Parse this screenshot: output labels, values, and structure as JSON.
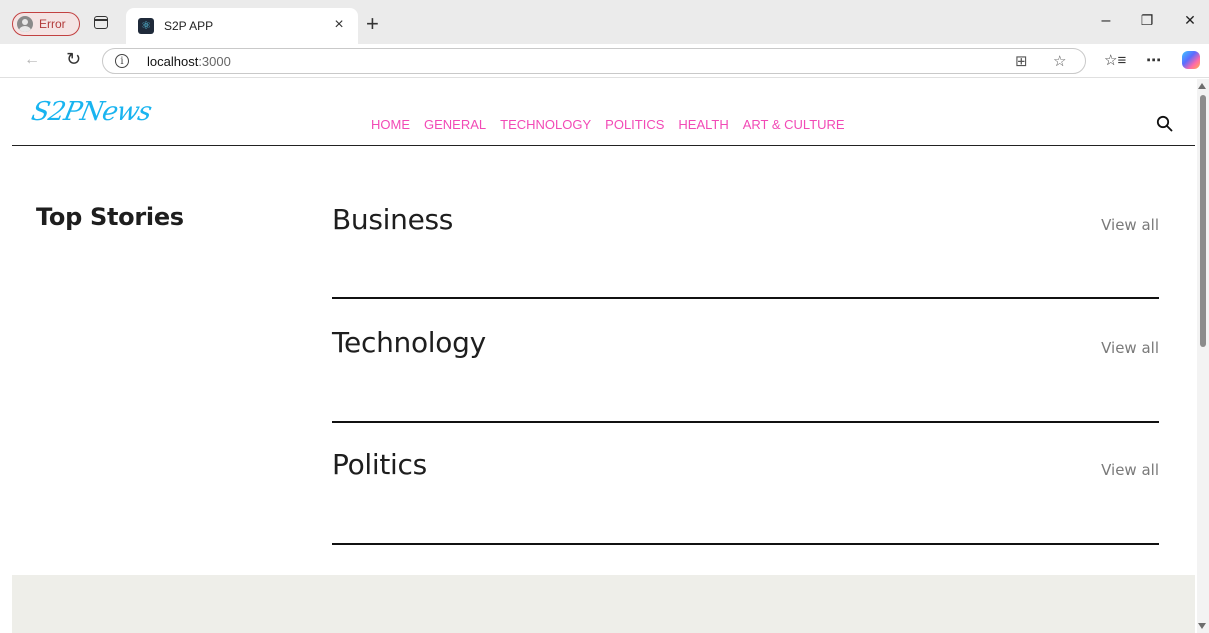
{
  "browser": {
    "profile_label": "Error",
    "tab_title": "S2P APP",
    "tab_close": "×",
    "new_tab": "+",
    "url_host": "localhost",
    "url_port": ":3000",
    "window_controls": {
      "minimize": "–",
      "restore": "❐",
      "close": "✕"
    },
    "icons": [
      "back-arrow-icon",
      "reload-icon",
      "info-icon",
      "split-screen-icon",
      "favorite-star-icon",
      "favorites-list-icon",
      "more-icon",
      "copilot-icon"
    ]
  },
  "site": {
    "logo_text": "S2PNews",
    "nav": [
      "HOME",
      "GENERAL",
      "TECHNOLOGY",
      "POLITICS",
      "HEALTH",
      "ART & CULTURE"
    ],
    "search_icon": "search-icon",
    "colors": {
      "logo": "#19b4f0",
      "nav": "#f24ab6",
      "footer": "#eeeee9"
    }
  },
  "sidebar": {
    "title": "Top Stories"
  },
  "sections": [
    {
      "title": "Business",
      "link": "View all"
    },
    {
      "title": "Technology",
      "link": "View all"
    },
    {
      "title": "Politics",
      "link": "View all"
    }
  ]
}
